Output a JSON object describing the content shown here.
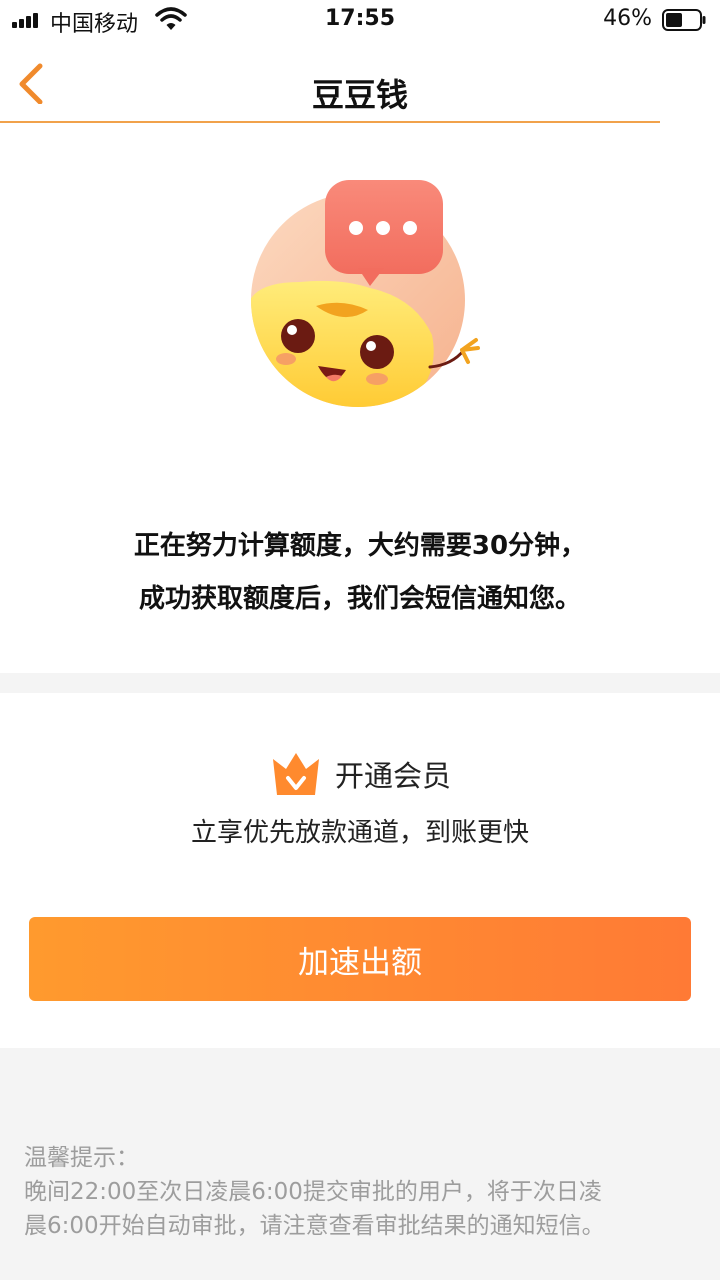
{
  "status_bar": {
    "carrier": "中国移动",
    "time": "17:55",
    "battery": "46%"
  },
  "nav": {
    "title": "豆豆钱"
  },
  "status": {
    "line1": "正在努力计算额度，大约需要30分钟，",
    "line2": "成功获取额度后，我们会短信通知您。"
  },
  "member": {
    "title": "开通会员",
    "subtitle": "立享优先放款通道，到账更快",
    "button_label": "加速出额"
  },
  "tips": {
    "heading": "温馨提示：",
    "line1": "晚间22:00至次日凌晨6:00提交审批的用户，将于次日凌",
    "line2": "晨6:00开始自动审批，请注意查看审批结果的通知短信。"
  },
  "colors": {
    "accent": "#ff8a32",
    "divider": "#f1a24b",
    "tip_text": "#9d9d9d"
  },
  "icons": [
    "signal-icon",
    "wifi-icon",
    "battery-icon",
    "back-chevron-icon",
    "mascot-icon",
    "chat-bubble-icon",
    "crown-icon"
  ]
}
